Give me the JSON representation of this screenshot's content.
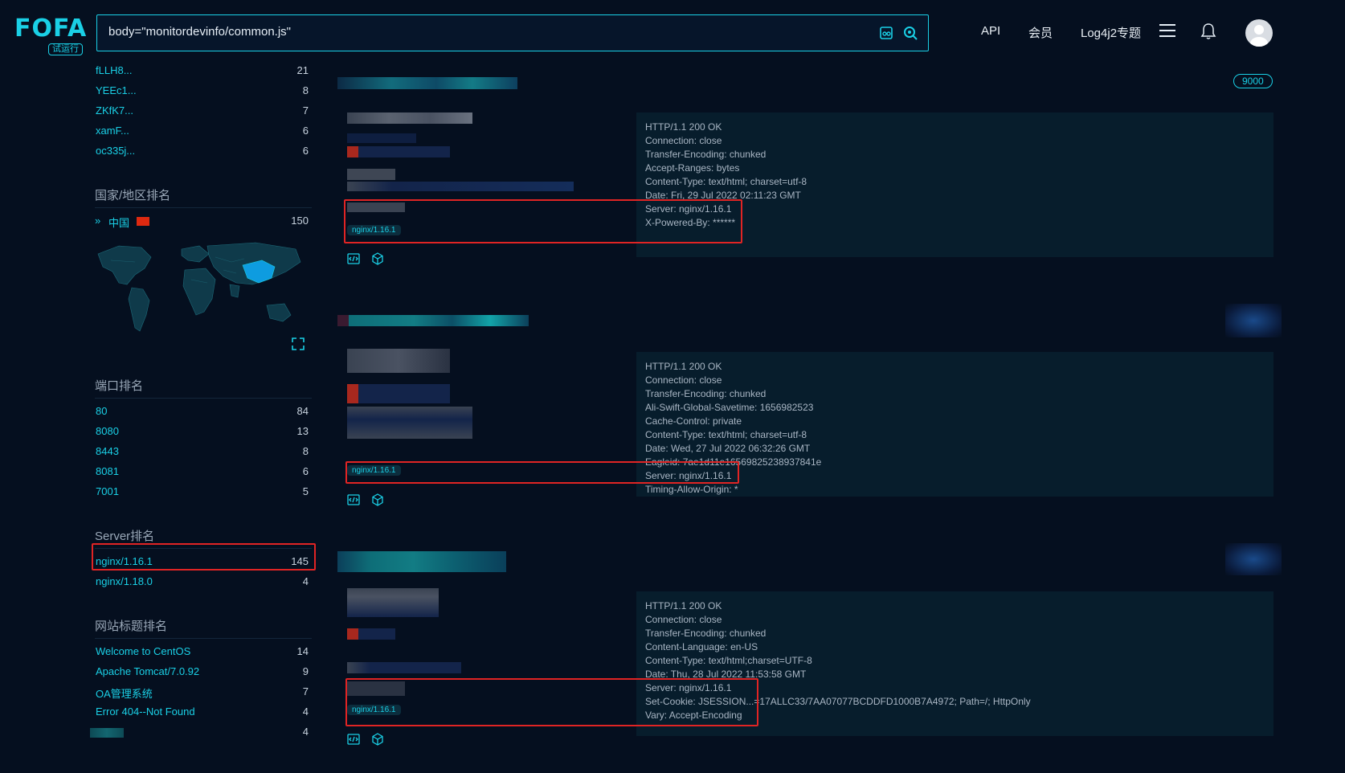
{
  "header": {
    "logo_text": "FOFA",
    "logo_badge": "试运行",
    "search_value": "body=\"monitordevinfo/common.js\"",
    "nav": [
      "API",
      "会员",
      "Log4j2专题"
    ]
  },
  "sidebar": {
    "top_items": [
      {
        "label": "fLLH8...",
        "count": "21"
      },
      {
        "label": "YEEc1...",
        "count": "8"
      },
      {
        "label": "ZKfK7...",
        "count": "7"
      },
      {
        "label": "xamF...",
        "count": "6"
      },
      {
        "label": "oc335j...",
        "count": "6"
      }
    ],
    "country_title": "国家/地区排名",
    "country": {
      "label": "中国",
      "count": "150"
    },
    "port_title": "端口排名",
    "ports": [
      {
        "label": "80",
        "count": "84"
      },
      {
        "label": "8080",
        "count": "13"
      },
      {
        "label": "8443",
        "count": "8"
      },
      {
        "label": "8081",
        "count": "6"
      },
      {
        "label": "7001",
        "count": "5"
      }
    ],
    "server_title": "Server排名",
    "servers": [
      {
        "label": "nginx/1.16.1",
        "count": "145"
      },
      {
        "label": "nginx/1.18.0",
        "count": "4"
      }
    ],
    "title_title": "网站标题排名",
    "titles": [
      {
        "label": "Welcome to CentOS",
        "count": "14"
      },
      {
        "label": "Apache Tomcat/7.0.92",
        "count": "9"
      },
      {
        "label": "OA管理系统",
        "count": "7"
      },
      {
        "label": "Error 404--Not Found",
        "count": "4"
      },
      {
        "label": "",
        "count": "4"
      }
    ]
  },
  "results": {
    "port_badge": "9000",
    "items": [
      {
        "tag": "nginx/1.16.1",
        "headers": [
          "HTTP/1.1 200 OK",
          "Connection: close",
          "Transfer-Encoding: chunked",
          "Accept-Ranges: bytes",
          "Content-Type: text/html; charset=utf-8",
          "Date: Fri, 29 Jul 2022 02:11:23 GMT",
          "Server: nginx/1.16.1",
          "X-Powered-By: ******"
        ]
      },
      {
        "tag": "nginx/1.16.1",
        "headers": [
          "HTTP/1.1 200 OK",
          "Connection: close",
          "Transfer-Encoding: chunked",
          "Ali-Swift-Global-Savetime: 1656982523",
          "Cache-Control: private",
          "Content-Type: text/html; charset=utf-8",
          "Date: Wed, 27 Jul 2022 06:32:26 GMT",
          "Eagleid: 7ae1d11e16569825238937841e",
          "Server: nginx/1.16.1",
          "Timing-Allow-Origin: *"
        ]
      },
      {
        "tag": "nginx/1.16.1",
        "headers": [
          "HTTP/1.1 200 OK",
          "Connection: close",
          "Transfer-Encoding: chunked",
          "Content-Language: en-US",
          "Content-Type: text/html;charset=UTF-8",
          "Date: Thu, 28 Jul 2022 11:53:58 GMT",
          "Server: nginx/1.16.1",
          "Set-Cookie: JSESSION...=17ALLC33/7AA07077BCDDFD1000B7A4972; Path=/; HttpOnly",
          "Vary: Accept-Encoding"
        ]
      }
    ]
  },
  "colors": {
    "accent": "#1ad0e6",
    "highlight": "#e02424",
    "background": "#050f1f"
  }
}
